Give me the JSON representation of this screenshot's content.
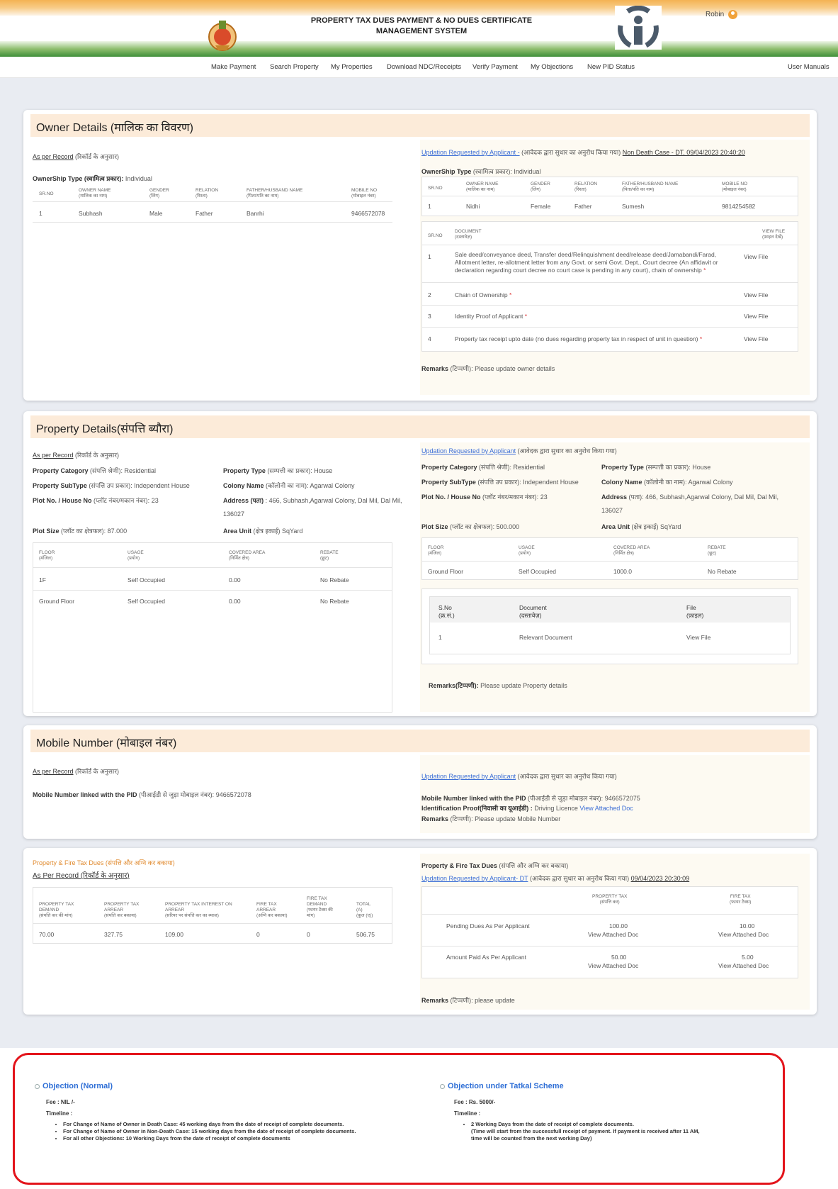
{
  "header": {
    "title_line1": "PROPERTY TAX DUES PAYMENT & NO DUES CERTIFICATE",
    "title_line2": "MANAGEMENT SYSTEM",
    "user_name": "Robin"
  },
  "nav": [
    "Make Payment",
    "Search Property",
    "My Properties",
    "Download NDC/Receipts",
    "Verify Payment",
    "My Objections",
    "New PID Status",
    "User Manuals"
  ],
  "owner": {
    "title": "Owner Details (मालिक का विवरण)",
    "left": {
      "as_per_record": "As per Record",
      "as_per_record_hi": "(रिकॉर्ड के अनुसार)",
      "ownership_label": "OwnerShip Type (स्वामित्व प्रकार):",
      "ownership_value": "Individual",
      "cols": [
        "SR.NO",
        "OWNER NAME",
        "(मालिक का नाम)",
        "GENDER",
        "(लिंग)",
        "RELATION",
        "(रिश्ता)",
        "FATHER/HUSBAND NAME",
        "(पिता/पति का नाम)",
        "MOBILE NO",
        "(मोबाइल नंबर)"
      ],
      "row": [
        "1",
        "Subhash",
        "Male",
        "Father",
        "Banrhi",
        "9466572078"
      ]
    },
    "right": {
      "updation": "Updation Requested by Applicant -",
      "updation_hi": "(आवेदक द्वारा सुधार का अनुरोध किया गया)",
      "case": "Non Death Case - DT. 09/04/2023 20:40:20",
      "ownership_label": "OwnerShip Type",
      "ownership_hi": "(स्वामित्व प्रकार):",
      "ownership_value": "Individual",
      "cols": [
        "SR.NO",
        "OWNER NAME",
        "(मालिक का नाम)",
        "GENDER",
        "(लिंग)",
        "RELATION",
        "(रिश्ता)",
        "FATHER/HUSBAND NAME",
        "(पिता/पति का नाम)",
        "MOBILE NO",
        "(मोबाइल नंबर)"
      ],
      "row": [
        "1",
        "Nidhi",
        "Female",
        "Father",
        "Sumesh",
        "9814254582"
      ],
      "doc_cols": [
        "SR.NO",
        "DOCUMENT",
        "(दस्तावेज़)",
        "VIEW FILE",
        "(फ़ाइल देखें)"
      ],
      "docs": [
        {
          "no": "1",
          "text": "Sale deed/conveyance deed, Transfer deed/Relinquishment deed/release deed/Jamabandi/Farad, Allotment letter, re-allotment letter from any Govt. or semi Govt. Dept., Court decree (An affidavit or declaration regarding court decree no court case is pending in any court), chain of ownership",
          "link": "View File"
        },
        {
          "no": "2",
          "text": "Chain of Ownership",
          "link": "View File"
        },
        {
          "no": "3",
          "text": "Identity Proof of Applicant",
          "link": "View File"
        },
        {
          "no": "4",
          "text": "Property tax receipt upto date (no dues regarding property tax in respect of unit in question)",
          "link": "View File"
        }
      ],
      "req": "*",
      "remarks_label": "Remarks",
      "remarks_hi": "(टिप्पणी):",
      "remarks": "Please update owner details"
    }
  },
  "property": {
    "title": "Property Details(संपत्ति ब्यौरा)",
    "left": {
      "as_per_record": "As per Record",
      "as_per_record_hi": "(रिकॉर्ड के अनुसार)",
      "category_label": "Property Category",
      "category_hi": "(संपत्ति श्रेणी):",
      "category": "Residential",
      "type_label": "Property Type",
      "type_hi": "(सम्पत्ती का प्रकार):",
      "type": "House",
      "subtype_label": "Property SubType",
      "subtype_hi": "(संपत्ति उप प्रकार):",
      "subtype": "Independent House",
      "colony_label": "Colony Name",
      "colony_hi": "(कॉलोनी का नाम):",
      "colony": "Agarwal Colony",
      "plot_label": "Plot No. / House No",
      "plot_hi": "(प्लॉट नंबर/मकान नंबर):",
      "plot": "23",
      "address_label": "Address (पता)",
      "address_line1": ": 466, Subhash,Agarwal Colony, Dal Mil, Dal Mil,",
      "address_line2": "136027",
      "size_label": "Plot Size",
      "size_hi": "(प्लॉट का क्षेत्रफल):",
      "size": "87.000",
      "unit_label": "Area Unit",
      "unit_hi": "(क्षेत्र इकाई)",
      "unit": "SqYard",
      "cols": [
        "FLOOR",
        "(मंजिल)",
        "USAGE",
        "(प्रयोग)",
        "COVERED AREA",
        "(निर्मित क्षेत्र)",
        "REBATE",
        "(छूट)"
      ],
      "rows": [
        [
          "1F",
          "Self Occupied",
          "0.00",
          "No Rebate"
        ],
        [
          "Ground Floor",
          "Self Occupied",
          "0.00",
          "No Rebate"
        ]
      ]
    },
    "right": {
      "updation": "Updation Requested by Applicant",
      "updation_hi": "(आवेदक द्वारा सुधार का अनुरोध किया गया)",
      "category": "Residential",
      "type": "House",
      "subtype": "Independent House",
      "colony": "Agarwal Colony",
      "plot": "23",
      "address_label": "Address",
      "address_hi": "(पता):",
      "address_line1": "466, Subhash,Agarwal Colony, Dal Mil, Dal Mil,",
      "address_line2": "136027",
      "size": "500.000",
      "unit": "SqYard",
      "rows": [
        [
          "Ground Floor",
          "Self Occupied",
          "1000.0",
          "No Rebate"
        ]
      ],
      "doc_cols": [
        "S.No",
        "(क्र.सं.)",
        "Document",
        "(दस्तावेज़)",
        "File",
        "(फ़ाइल)"
      ],
      "doc_row": [
        "1",
        "Relevant Document",
        "View File"
      ],
      "remarks_label": "Remarks(टिप्पणी):",
      "remarks": "Please update Property details"
    }
  },
  "mobile": {
    "title": "Mobile Number (मोबाइल नंबर)",
    "left_label": "Mobile Number linked with the PID",
    "left_hi": "(पीआईडी से जुड़ा मोबाइल नंबर):",
    "left_value": "9466572078",
    "right_value": "9466572075",
    "id_label": "Identification Proof(निवासी का यूआईडी) :",
    "id_value": "Driving Licence",
    "id_link": "View Attached Doc",
    "remarks": "Please update Mobile Number"
  },
  "dues": {
    "left_title": "Property & Fire Tax Dues (संपत्ति और अग्नि कर बकाया)",
    "left_record": "As Per Record (रिकॉर्ड के अनुसार)",
    "cols": [
      "PROPERTY TAX",
      "DEMAND",
      "(संपत्ति कर की मांग)",
      "PROPERTY TAX",
      "ARREAR",
      "(संपत्ति कर बकाया)",
      "PROPERTY TAX INTEREST ON",
      "ARREAR",
      "(सरियर पर संपत्ति कर का ब्याज)",
      "FIRE TAX",
      "ARREAR",
      "(अग्नि कर बकाया)",
      "FIRE TAX",
      "DEMAND",
      "(फायर टैक्स की",
      "मांग)",
      "TOTAL",
      "(A)",
      "(कुल (ए))"
    ],
    "row": [
      "70.00",
      "327.75",
      "109.00",
      "0",
      "0",
      "506.75"
    ],
    "right_title": "Property & Fire Tax Dues",
    "right_title_hi": "(संपत्ति और अग्नि कर बकाया)",
    "right_updation": "Updation Requested by Applicant- DT",
    "right_date": "09/04/2023 20:30:09",
    "right_cols": [
      "PROPERTY TAX",
      "(संपत्ति कर)",
      "FIRE TAX",
      "(फायर टैक्स)"
    ],
    "right_rows": [
      {
        "label": "Pending Dues As Per Applicant",
        "pt": "100.00",
        "ft": "10.00",
        "link": "View Attached Doc"
      },
      {
        "label": "Amount Paid As Per Applicant",
        "pt": "50.00",
        "ft": "5.00",
        "link": "View Attached Doc"
      }
    ],
    "remarks": "please update"
  },
  "objections": {
    "normal": {
      "title": "Objection (Normal)",
      "fee": "Fee : NIL /-",
      "timeline": "Timeline :",
      "items": [
        "For Change of Name of Owner in Death Case: 45 working days from the date of receipt of complete documents.",
        "For Change of Name of Owner in Non-Death Case: 15 working days from the date of receipt of complete documents.",
        "For all other Objections: 10 Working Days from the date of receipt of complete documents"
      ]
    },
    "tatkal": {
      "title": "Objection under Tatkal Scheme",
      "fee": "Fee : Rs. 5000/-",
      "timeline": "Timeline :",
      "item": "2 Working Days from the date of receipt of complete documents.",
      "note_line1": "(Time will start from the successfull receipt of payment. If payment is received after 11 AM,",
      "note_line2": "time will be counted from the next working Day)"
    }
  }
}
